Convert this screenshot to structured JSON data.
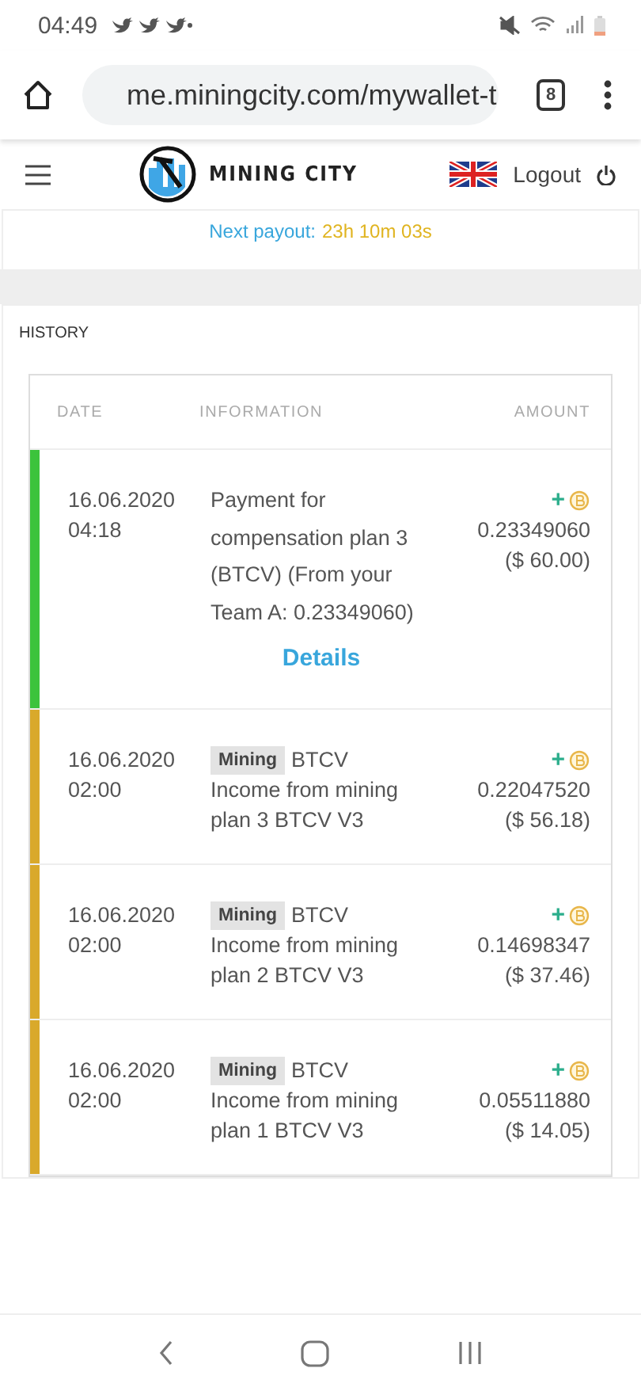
{
  "status_bar": {
    "time": "04:49"
  },
  "browser": {
    "url": "me.miningcity.com/mywallet-t",
    "tab_count": "8"
  },
  "header": {
    "brand": "MINING CITY",
    "logout": "Logout"
  },
  "payout": {
    "label": "Next payout:",
    "time": "23h 10m 03s"
  },
  "history": {
    "title": "HISTORY",
    "columns": [
      "DATE",
      "INFORMATION",
      "AMOUNT"
    ],
    "rows": [
      {
        "kind": "payment",
        "color": "#3cc33c",
        "date": "16.06.2020",
        "time": "04:18",
        "description": "Payment for compensation plan 3 (BTCV) (From your Team A: 0.23349060)",
        "link": "Details",
        "sign": "+",
        "amount": "0.23349060",
        "usd": "($ 60.00)"
      },
      {
        "kind": "mining",
        "color": "#d9a92b",
        "date": "16.06.2020",
        "time": "02:00",
        "tag": "Mining",
        "coin": "BTCV",
        "description": "Income from mining plan 3 BTCV V3",
        "sign": "+",
        "amount": "0.22047520",
        "usd": "($ 56.18)"
      },
      {
        "kind": "mining",
        "color": "#d9a92b",
        "date": "16.06.2020",
        "time": "02:00",
        "tag": "Mining",
        "coin": "BTCV",
        "description": "Income from mining plan 2 BTCV V3",
        "sign": "+",
        "amount": "0.14698347",
        "usd": "($ 37.46)"
      },
      {
        "kind": "mining",
        "color": "#d9a92b",
        "date": "16.06.2020",
        "time": "02:00",
        "tag": "Mining",
        "coin": "BTCV",
        "description": "Income from mining plan 1 BTCV V3",
        "sign": "+",
        "amount": "0.05511880",
        "usd": "($ 14.05)"
      }
    ]
  }
}
